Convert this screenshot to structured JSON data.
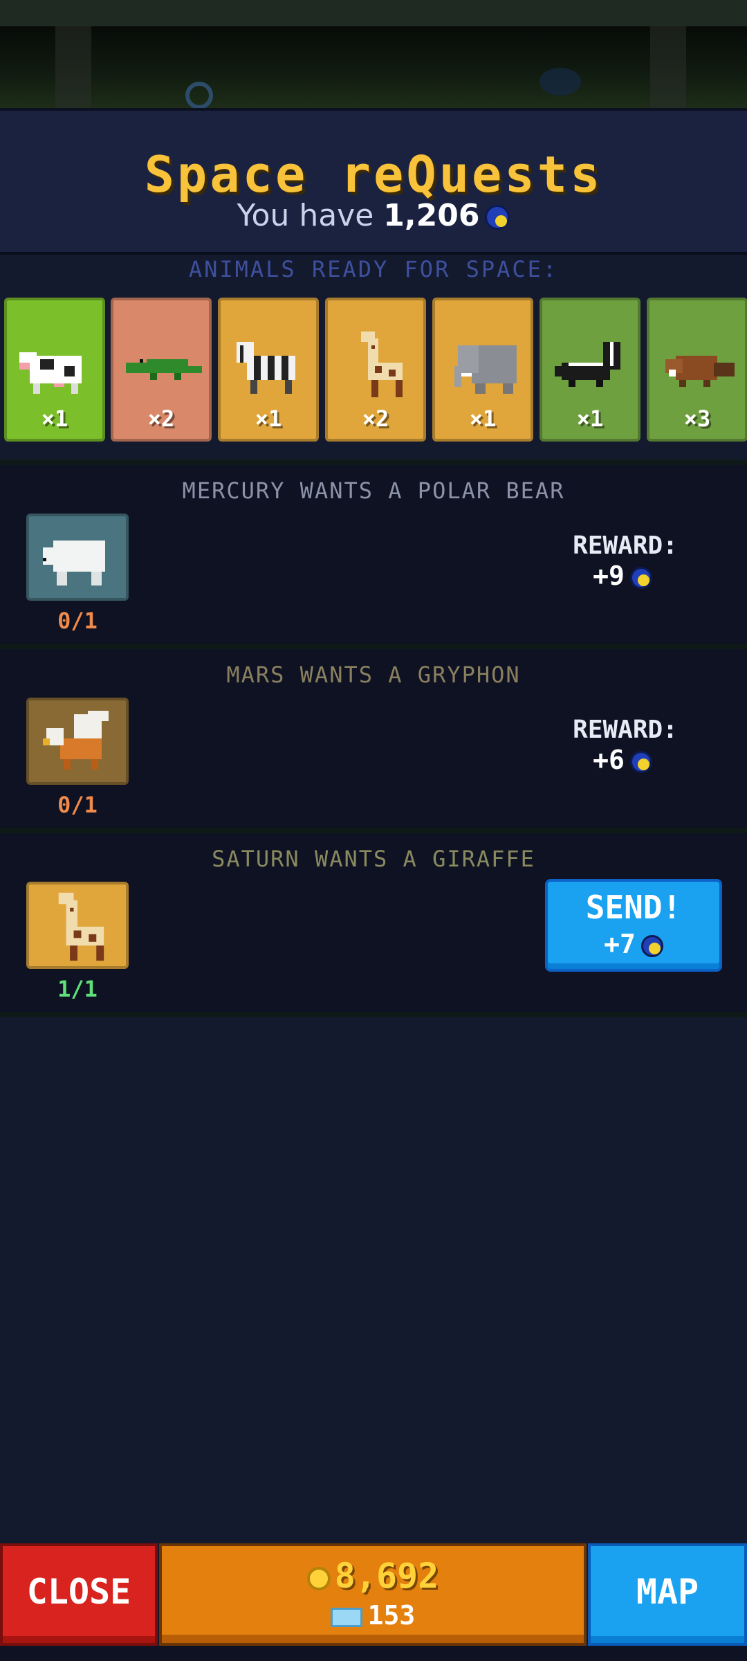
{
  "header": {
    "title": "Space reQuests",
    "you_have_label": "You have",
    "balance": "1,206",
    "currency_icon": "moon-coin-icon"
  },
  "animals_label": "ANIMALS READY FOR SPACE:",
  "animals": [
    {
      "name": "cow",
      "count": "×1",
      "tile_color": "#7bbf2a"
    },
    {
      "name": "crocodile",
      "count": "×2",
      "tile_color": "#d9896a"
    },
    {
      "name": "zebra",
      "count": "×1",
      "tile_color": "#e0a63c"
    },
    {
      "name": "giraffe",
      "count": "×2",
      "tile_color": "#e0a63c"
    },
    {
      "name": "elephant",
      "count": "×1",
      "tile_color": "#e0a63c"
    },
    {
      "name": "skunk",
      "count": "×1",
      "tile_color": "#6fa040"
    },
    {
      "name": "beaver",
      "count": "×3",
      "tile_color": "#6fa040"
    }
  ],
  "requests": [
    {
      "title": "MERCURY WANTS A POLAR BEAR",
      "title_color": "#8c93a8",
      "animal": "polar-bear",
      "tile_color": "#4a7480",
      "progress": "0/1",
      "progress_color": "#f08a4a",
      "reward_label": "REWARD:",
      "reward": "+9"
    },
    {
      "title": "MARS WANTS A GRYPHON",
      "title_color": "#8a8060",
      "animal": "gryphon",
      "tile_color": "#8a6a34",
      "progress": "0/1",
      "progress_color": "#f08a4a",
      "reward_label": "REWARD:",
      "reward": "+6"
    },
    {
      "title": "SATURN WANTS A GIRAFFE",
      "title_color": "#8a8a60",
      "animal": "giraffe",
      "tile_color": "#e0a63c",
      "progress": "1/1",
      "progress_color": "#5fe07a",
      "send_label": "SEND!",
      "reward": "+7"
    }
  ],
  "bottom": {
    "close_label": "CLOSE",
    "gold": "8,692",
    "gems": "153",
    "map_label": "MAP"
  }
}
